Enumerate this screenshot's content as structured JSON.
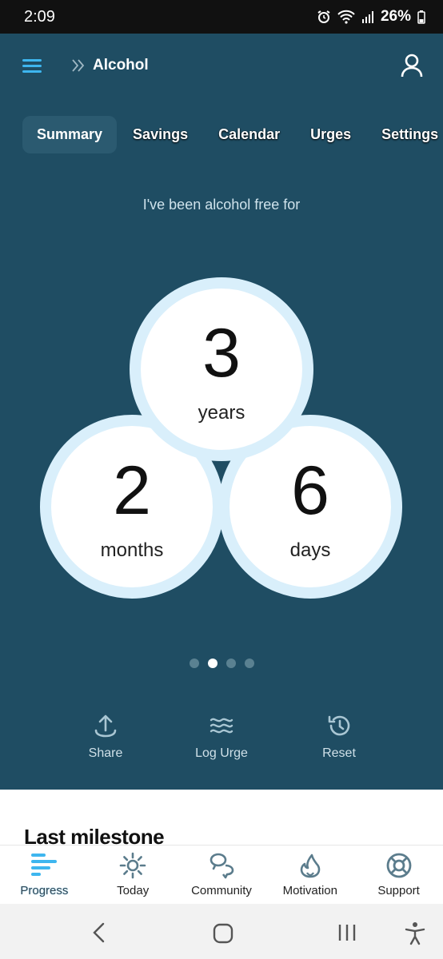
{
  "status_bar": {
    "time": "2:09",
    "battery": "26%"
  },
  "header": {
    "title": "Alcohol"
  },
  "tabs": [
    {
      "label": "Summary",
      "active": true
    },
    {
      "label": "Savings",
      "active": false
    },
    {
      "label": "Calendar",
      "active": false
    },
    {
      "label": "Urges",
      "active": false
    },
    {
      "label": "Settings",
      "active": false
    }
  ],
  "summary": {
    "headline": "I've been alcohol free for",
    "years": {
      "value": "3",
      "unit": "years"
    },
    "months": {
      "value": "2",
      "unit": "months"
    },
    "days": {
      "value": "6",
      "unit": "days"
    }
  },
  "pager": {
    "count": 4,
    "active_index": 1
  },
  "actions": {
    "share": "Share",
    "log_urge": "Log Urge",
    "reset": "Reset"
  },
  "milestone": {
    "title": "Last milestone"
  },
  "bottom_nav": [
    {
      "label": "Progress",
      "icon": "progress-icon",
      "active": true
    },
    {
      "label": "Today",
      "icon": "sun-icon",
      "active": false
    },
    {
      "label": "Community",
      "icon": "community-icon",
      "active": false
    },
    {
      "label": "Motivation",
      "icon": "flame-icon",
      "active": false
    },
    {
      "label": "Support",
      "icon": "lifebuoy-icon",
      "active": false
    }
  ],
  "colors": {
    "background": "#1f4d63",
    "accent": "#3eb6ef",
    "circle_ring": "#d9effb"
  }
}
